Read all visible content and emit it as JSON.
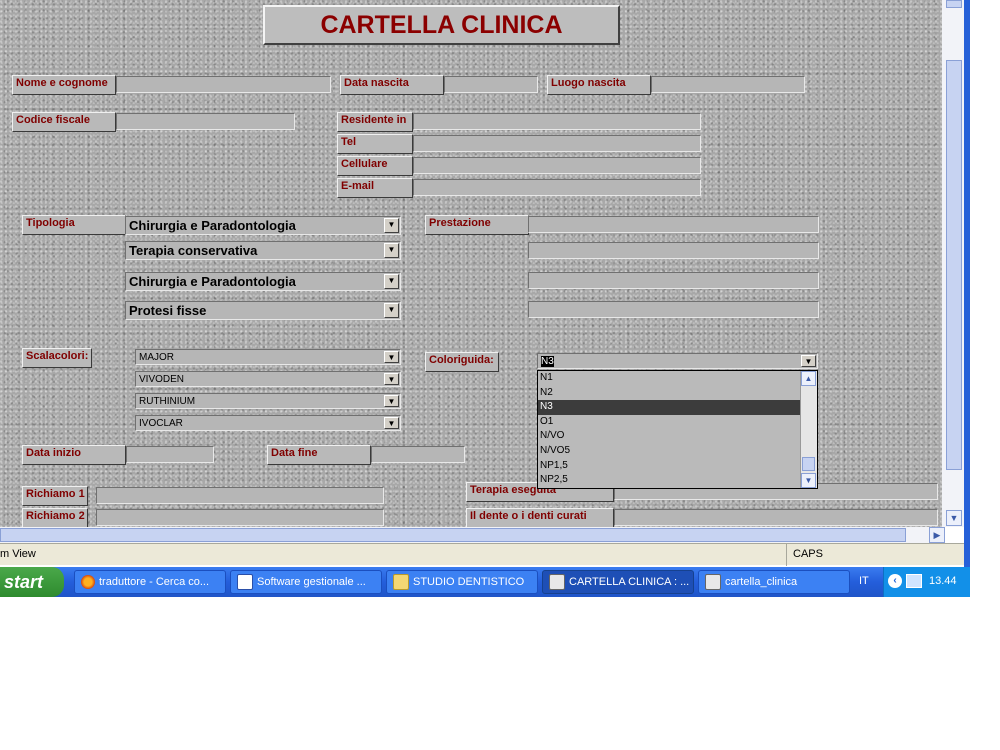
{
  "form": {
    "title": "CARTELLA CLINICA",
    "labels": {
      "nome": "Nome e cognome",
      "data_nascita": "Data nascita",
      "luogo_nascita": "Luogo nascita",
      "codice_fiscale": "Codice fiscale",
      "residente": "Residente in",
      "tel": "Tel",
      "cellulare": "Cellulare",
      "email": "E-mail",
      "tipologia": "Tipologia",
      "prestazione": "Prestazione",
      "scalacolori": "Scalacolori:",
      "coloriguida": "Coloriguida:",
      "data_inizio": "Data inizio",
      "data_fine": "Data fine",
      "richiamo1": "Richiamo 1",
      "richiamo2": "Richiamo 2",
      "terapia_eseguita": "Terapia eseguita",
      "dente": "Il dente o i denti curati"
    },
    "tipologia_values": [
      "Chirurgia e Paradontologia",
      "Terapia conservativa",
      "Chirurgia e Paradontologia",
      "Protesi fisse"
    ],
    "scalacolori_values": [
      "MAJOR",
      "VIVODEN",
      "RUTHINIUM",
      "IVOCLAR"
    ],
    "coloriguida_value": "N3",
    "coloriguida_options": [
      "N1",
      "N2",
      "N3",
      "O1",
      "N/VO",
      "N/VO5",
      "NP1,5",
      "NP2,5"
    ],
    "coloriguida_selected_index": 2
  },
  "statusbar": {
    "left": "m View",
    "caps": "CAPS"
  },
  "taskbar": {
    "start": "start",
    "tasks": [
      {
        "label": "traduttore - Cerca co...",
        "icon": "firefox-icon"
      },
      {
        "label": "Software gestionale ...",
        "icon": "word-icon"
      },
      {
        "label": "STUDIO DENTISTICO",
        "icon": "folder-icon"
      },
      {
        "label": "CARTELLA CLINICA : ...",
        "icon": "access-form-icon"
      },
      {
        "label": "cartella_clinica",
        "icon": "access-table-icon"
      }
    ],
    "language": "IT",
    "clock": "13.44"
  },
  "colors": {
    "label_text": "#800000",
    "title_text": "#8b0000",
    "taskbar": "#245edb",
    "start_button": "#3c9a3c"
  }
}
